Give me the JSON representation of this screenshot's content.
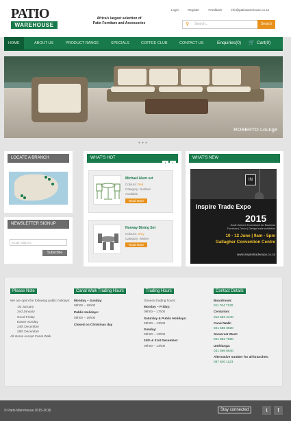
{
  "brand": {
    "logo_top": "PATIO",
    "logo_bottom": "WAREHOUSE",
    "tagline_1": "Africa's largest selection of",
    "tagline_2": "Patio Furniture and Accessories"
  },
  "header": {
    "links": [
      "Login",
      "Register",
      "Feedback",
      "info@patiowarehouse.co.za"
    ],
    "search_placeholder": "Search...",
    "search_button": "Search"
  },
  "nav": {
    "items": [
      "HOME",
      "ABOUT US",
      "PRODUCT RANGE",
      "SPECIALS",
      "COFFEE CLUB",
      "CONTACT US"
    ],
    "enquiries": "Enquiries(0)",
    "cart": "Cart(0)"
  },
  "hero": {
    "caption": "ROBERTO Lounge"
  },
  "locate": {
    "title": "LOCATE A BRANCH"
  },
  "newsletter": {
    "title": "NEWSLETTER SIGNUP",
    "placeholder": "Email Address",
    "button": "Subscribe"
  },
  "whats_hot": {
    "title": "WHAT'S HOT",
    "products": [
      {
        "name": "Michael Alum set",
        "colours_label": "Colours:",
        "colours": "Red",
        "category_label": "Category:",
        "category": "Outdoor",
        "extra": "Available",
        "button": "Read More"
      },
      {
        "name": "Norway Dining Set",
        "colours_label": "Colours:",
        "colours": "Grey",
        "category_label": "Category:",
        "category": "Wicker",
        "extra": "",
        "button": "Read More"
      }
    ]
  },
  "whats_new": {
    "title": "WHAT'S NEW",
    "badge": "IN",
    "expo_title": "Inspire Trade Expo",
    "expo_year": "2015",
    "expo_sub_1": "South Africa's Touchstone for Business",
    "expo_sub_2": "Furniture | Décor | Design trade exhibition",
    "expo_dates": "10 - 12 June | 9am - 5pm",
    "expo_venue": "Gallagher Convention Centre",
    "expo_url": "www.inspiretradeexpo.co.za"
  },
  "footer": {
    "please_note": {
      "title": "Please Note",
      "intro": "We are open the following public holidays:",
      "items": [
        "1st January",
        "2nd January",
        "Good Friday",
        "Easter Sunday",
        "24th December",
        "26th December"
      ],
      "outro": "All stores except Canal Walk"
    },
    "canal_walk": {
      "title": "Canal Walk Trading Hours",
      "l1_label": "Monday – Sunday:",
      "l1": "09h00 – 19h00",
      "l2_label": "Public Holidays:",
      "l2": "09h00 – 19h00",
      "l3": "Closed on Christmas day"
    },
    "trading": {
      "title": "Trading Hours",
      "intro": "General trading hours:",
      "l1_label": "Monday – Friday:",
      "l1": "09h00 – 17h00",
      "l2_label": "Saturday & Public Holidays:",
      "l2": "09h00 – 13h00",
      "l3_label": "Sunday:",
      "l3": "09h00 – 13h00",
      "l4_label": "24th & 31st December:",
      "l4": "09h00 – 13h00"
    },
    "contact": {
      "title": "Contact Details",
      "l1_label": "Boardroom:",
      "l1": "011 704 7120",
      "l2_label": "Centurion:",
      "l2": "012 653 4440",
      "l3_label": "Canal Walk:",
      "l3": "021 555 3920",
      "l4_label": "Somerset West:",
      "l4": "021 852 7580",
      "l5_label": "Umhlanga:",
      "l5": "031 566 6640",
      "l6_label": "Alternative number for all branches:",
      "l6": "087 820 1123"
    }
  },
  "bottom": {
    "copyright": "© Patio Warehouse 2015-2016",
    "stay": "Stay connected",
    "twitter": "t",
    "facebook": "f"
  }
}
